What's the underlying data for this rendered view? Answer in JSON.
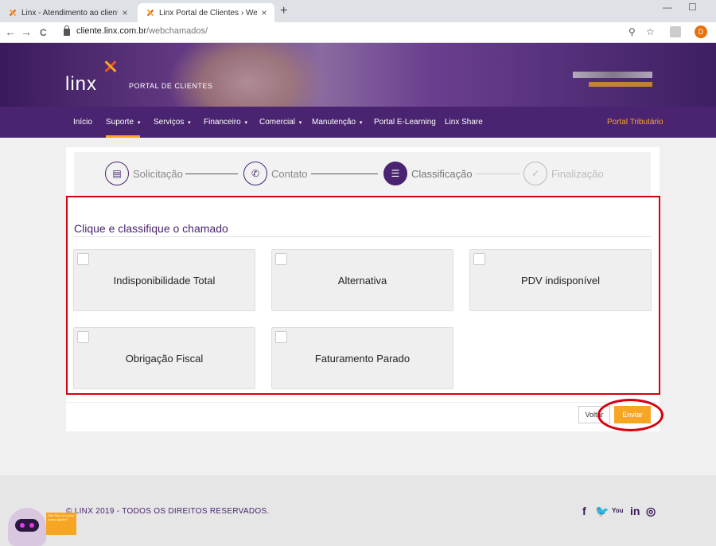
{
  "browser": {
    "tabs": [
      {
        "label": "Linx - Atendimento ao cliente",
        "close": "×"
      },
      {
        "label": "Linx Portal de Clientes › Webchamados",
        "close": "×"
      }
    ],
    "new_tab": "+",
    "back": "←",
    "forward": "→",
    "reload": "C",
    "url_host": "cliente.linx.com.br",
    "url_path": "/webchamados/",
    "search_icon": "⚲",
    "star_icon": "☆",
    "profile_initial": "D",
    "minimize": "—",
    "maximize": "☐"
  },
  "header": {
    "logo_text": "linx",
    "portal_subtitle": "PORTAL DE CLIENTES"
  },
  "nav": {
    "items": [
      {
        "label": "Início",
        "caret": ""
      },
      {
        "label": "Suporte",
        "caret": "▾"
      },
      {
        "label": "Serviços",
        "caret": "▾"
      },
      {
        "label": "Financeiro",
        "caret": "▾"
      },
      {
        "label": "Comercial",
        "caret": "▾"
      },
      {
        "label": "Manutenção",
        "caret": "▾"
      },
      {
        "label": "Portal E-Learning",
        "caret": ""
      },
      {
        "label": "Linx Share",
        "caret": ""
      }
    ],
    "right_link": "Portal Tributário"
  },
  "steps": [
    {
      "label": "Solicitação",
      "icon": "▤",
      "state": "done"
    },
    {
      "label": "Contato",
      "icon": "✆",
      "state": "done"
    },
    {
      "label": "Classificação",
      "icon": "☰",
      "state": "current"
    },
    {
      "label": "Finalização",
      "icon": "✓",
      "state": "todo"
    }
  ],
  "classification": {
    "title": "Clique e classifique o chamado",
    "options": [
      {
        "label": "Indisponibilidade Total"
      },
      {
        "label": "Alternativa"
      },
      {
        "label": "PDV indisponível"
      },
      {
        "label": "Obrigação Fiscal"
      },
      {
        "label": "Faturamento Parado"
      }
    ]
  },
  "actions": {
    "back_label": "Voltar",
    "submit_label": "Enviar"
  },
  "footer": {
    "copyright": "© LINX 2019 - TODOS OS DIREITOS RESERVADOS.",
    "social": [
      "f",
      "🐦",
      "You",
      "in",
      "◎"
    ],
    "bot_bubble": "Olá! Sou Lu! como posso ajudar?"
  },
  "colors": {
    "brand_purple": "#4a2470",
    "accent_orange": "#f6a623",
    "highlight_red": "#d8000c"
  }
}
